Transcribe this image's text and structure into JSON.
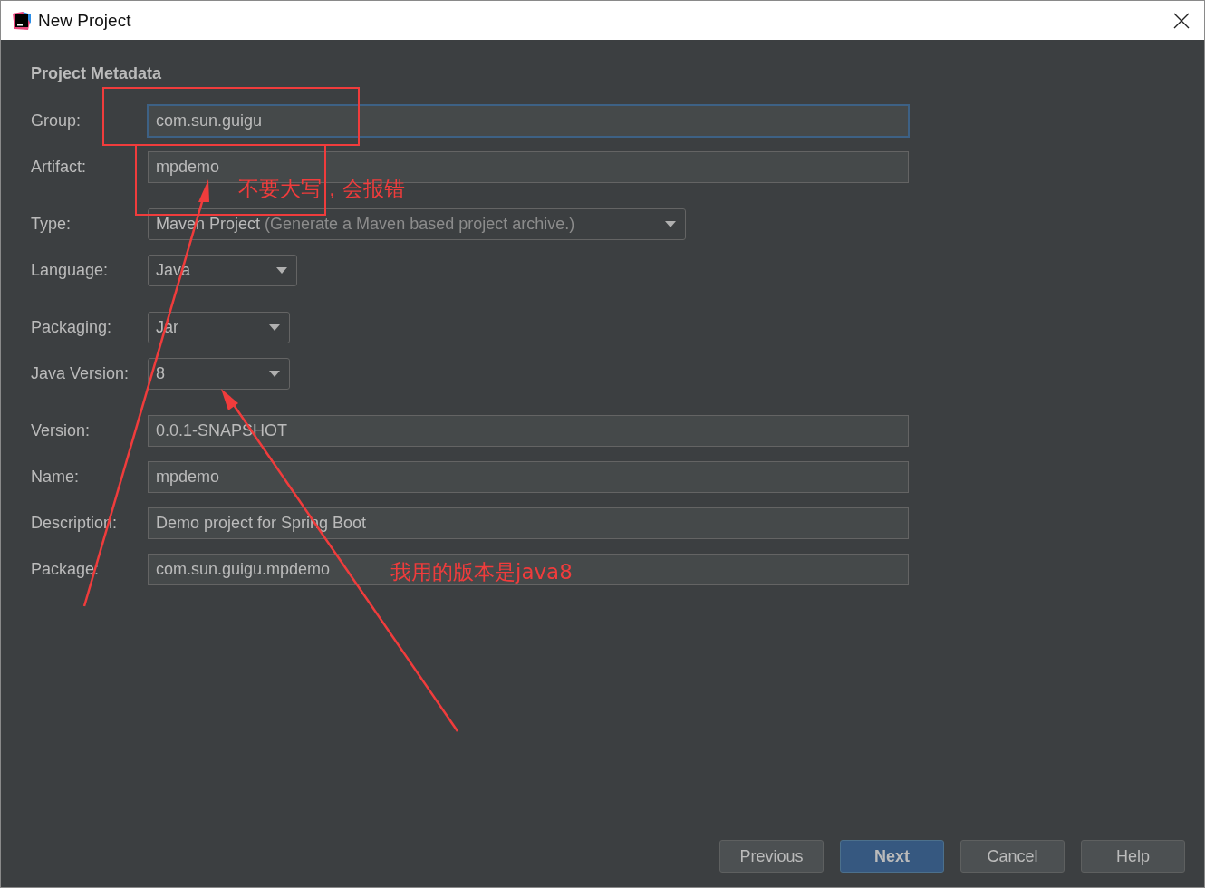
{
  "window": {
    "title": "New Project"
  },
  "section_title": "Project Metadata",
  "groups": [
    [
      {
        "label": "Group:",
        "kind": "text",
        "value": "com.sun.guigu",
        "focused": true
      },
      {
        "label": "Artifact:",
        "kind": "text",
        "value": "mpdemo",
        "focused": false
      }
    ],
    [
      {
        "label": "Type:",
        "kind": "combo",
        "value": "Maven Project",
        "detail": "(Generate a Maven based project archive.)",
        "focused": false
      },
      {
        "label": "Language:",
        "kind": "combo",
        "value": "Java",
        "focused": false
      }
    ],
    [
      {
        "label": "Packaging:",
        "kind": "combo",
        "value": "Jar",
        "focused": false
      },
      {
        "label": "Java Version:",
        "kind": "combo",
        "value": "8",
        "focused": false
      }
    ],
    [
      {
        "label": "Version:",
        "kind": "text",
        "value": "0.0.1-SNAPSHOT",
        "focused": false
      },
      {
        "label": "Name:",
        "kind": "text",
        "value": "mpdemo",
        "focused": false
      },
      {
        "label": "Description:",
        "kind": "text",
        "value": "Demo project for Spring Boot",
        "focused": false
      },
      {
        "label": "Package:",
        "kind": "text",
        "value": "com.sun.guigu.mpdemo",
        "focused": false
      }
    ]
  ],
  "notes": [
    "不要大写，会报错",
    "我用的版本是java8"
  ],
  "buttons": [
    {
      "label": "Previous",
      "default": false
    },
    {
      "label": "Next",
      "default": true
    },
    {
      "label": "Cancel",
      "default": false
    },
    {
      "label": "Help",
      "default": false
    }
  ]
}
